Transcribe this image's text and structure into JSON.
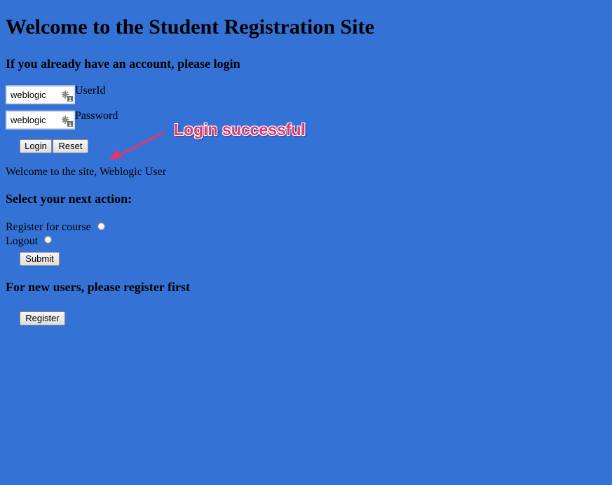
{
  "page": {
    "title": "Welcome to the Student Registration Site",
    "background_color": "#3472d6"
  },
  "login": {
    "heading": "If you already have an account, please login",
    "userid_value": "weblogic",
    "userid_label": "UserId",
    "password_value": "weblogic",
    "password_label": "Password",
    "login_button": "Login",
    "reset_button": "Reset",
    "field_icon": "key-autofill-icon"
  },
  "annotation": {
    "text": "Login successful",
    "color": "#e8336b",
    "arrow_icon": "arrow-icon"
  },
  "welcome_message": "Welcome to the site, Weblogic User",
  "actions": {
    "heading": "Select your next action:",
    "options": [
      {
        "label": "Register for course",
        "checked": false
      },
      {
        "label": "Logout",
        "checked": false
      }
    ],
    "submit_button": "Submit"
  },
  "register": {
    "heading": "For new users, please register first",
    "register_button": "Register"
  }
}
